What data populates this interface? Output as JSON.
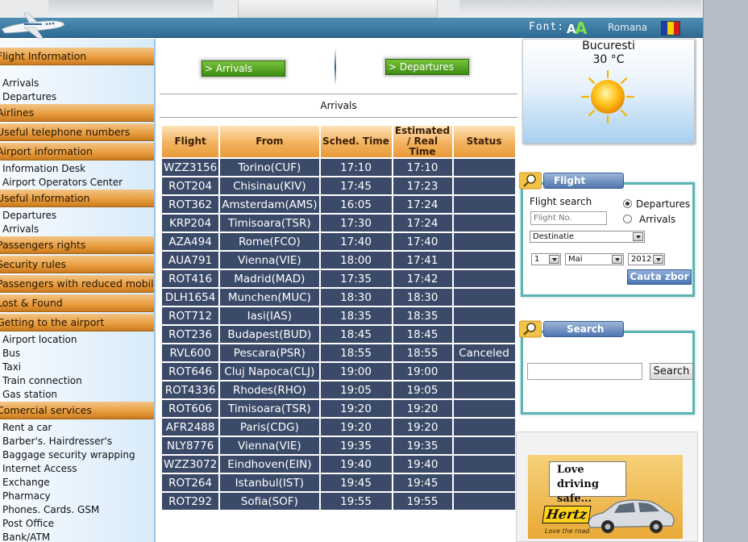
{
  "header": {
    "font_label": "Font:",
    "font_small": "A",
    "font_large": "A",
    "language_link": "Romana",
    "colors": {
      "banner": "#3b7aa3",
      "accent_green": "#7de04a"
    },
    "flag_icon": "romania-flag-icon"
  },
  "sidebar": {
    "sections": [
      {
        "title": "Flight Information",
        "items": [
          "Arrivals",
          "Departures"
        ]
      },
      {
        "title": "Airlines",
        "items": []
      },
      {
        "title": "Useful telephone numbers",
        "items": []
      },
      {
        "title": "Airport information",
        "items": [
          "Information Desk",
          "Airport Operators Center"
        ]
      },
      {
        "title": "Useful Information",
        "items": [
          "Departures",
          "Arrivals"
        ]
      },
      {
        "title": "Passengers rights",
        "items": []
      },
      {
        "title": "Security rules",
        "items": []
      },
      {
        "title": "Passengers with reduced mobility",
        "items": []
      },
      {
        "title": "Lost & Found",
        "items": []
      },
      {
        "title": "Getting to the airport",
        "items": [
          "Airport location",
          "Bus",
          "Taxi",
          "Train connection",
          "Gas station"
        ]
      },
      {
        "title": "Comercial services",
        "items": [
          "Rent a car",
          "Barber's. Hairdresser's",
          "Baggage security wrapping",
          "Internet Access",
          "Exchange",
          "Pharmacy",
          "Phones. Cards. GSM",
          "Post Office",
          "Bank/ATM"
        ]
      }
    ]
  },
  "tabs": {
    "arrivals": "> Arrivals",
    "departures": "> Departures"
  },
  "main": {
    "section_title": "Arrivals"
  },
  "table": {
    "headers": [
      "Flight",
      "From",
      "Sched. Time",
      "Estimated / Real Time",
      "Status"
    ],
    "rows": [
      {
        "flight": "WZZ3156",
        "from": "Torino(CUF)",
        "sched": "17:10",
        "real": "17:10",
        "status": ""
      },
      {
        "flight": "ROT204",
        "from": "Chisinau(KIV)",
        "sched": "17:45",
        "real": "17:23",
        "status": ""
      },
      {
        "flight": "ROT362",
        "from": "Amsterdam(AMS)",
        "sched": "16:05",
        "real": "17:24",
        "status": ""
      },
      {
        "flight": "KRP204",
        "from": "Timisoara(TSR)",
        "sched": "17:30",
        "real": "17:24",
        "status": ""
      },
      {
        "flight": "AZA494",
        "from": "Rome(FCO)",
        "sched": "17:40",
        "real": "17:40",
        "status": ""
      },
      {
        "flight": "AUA791",
        "from": "Vienna(VIE)",
        "sched": "18:00",
        "real": "17:41",
        "status": ""
      },
      {
        "flight": "ROT416",
        "from": "Madrid(MAD)",
        "sched": "17:35",
        "real": "17:42",
        "status": ""
      },
      {
        "flight": "DLH1654",
        "from": "Munchen(MUC)",
        "sched": "18:30",
        "real": "18:30",
        "status": ""
      },
      {
        "flight": "ROT712",
        "from": "Iasi(IAS)",
        "sched": "18:35",
        "real": "18:35",
        "status": ""
      },
      {
        "flight": "ROT236",
        "from": "Budapest(BUD)",
        "sched": "18:45",
        "real": "18:45",
        "status": ""
      },
      {
        "flight": "RVL600",
        "from": "Pescara(PSR)",
        "sched": "18:55",
        "real": "18:55",
        "status": "Canceled"
      },
      {
        "flight": "ROT646",
        "from": "Cluj Napoca(CLJ)",
        "sched": "19:00",
        "real": "19:00",
        "status": ""
      },
      {
        "flight": "ROT4336",
        "from": "Rhodes(RHO)",
        "sched": "19:05",
        "real": "19:05",
        "status": ""
      },
      {
        "flight": "ROT606",
        "from": "Timisoara(TSR)",
        "sched": "19:20",
        "real": "19:20",
        "status": ""
      },
      {
        "flight": "AFR2488",
        "from": "Paris(CDG)",
        "sched": "19:20",
        "real": "19:20",
        "status": ""
      },
      {
        "flight": "NLY8776",
        "from": "Vienna(VIE)",
        "sched": "19:35",
        "real": "19:35",
        "status": ""
      },
      {
        "flight": "WZZ3072",
        "from": "Eindhoven(EIN)",
        "sched": "19:40",
        "real": "19:40",
        "status": ""
      },
      {
        "flight": "ROT264",
        "from": "Istanbul(IST)",
        "sched": "19:45",
        "real": "19:45",
        "status": ""
      },
      {
        "flight": "ROT292",
        "from": "Sofia(SOF)",
        "sched": "19:55",
        "real": "19:55",
        "status": ""
      }
    ],
    "colors": {
      "row_bg": "#3a4a68",
      "header_bg": "#f3b25e"
    }
  },
  "weather": {
    "city": "Bucuresti",
    "temperature": "30 °C",
    "icon": "sun-icon"
  },
  "flight_search": {
    "tab_label": "Flight search",
    "label": "Flight search",
    "radio_departures": "Departures",
    "radio_arrivals": "Arrivals",
    "selected": "Departures",
    "flight_no_placeholder": "Flight No.",
    "destination": "Destinatie",
    "day": "1",
    "month": "Mai",
    "year": "2012",
    "submit_label": "Cauta zbor"
  },
  "search": {
    "tab_label": "Search",
    "button_label": "Search",
    "value": ""
  },
  "ad": {
    "line1": "Love",
    "line2": "driving safe...",
    "brand": "Hertz",
    "tagline": "Love the road"
  }
}
